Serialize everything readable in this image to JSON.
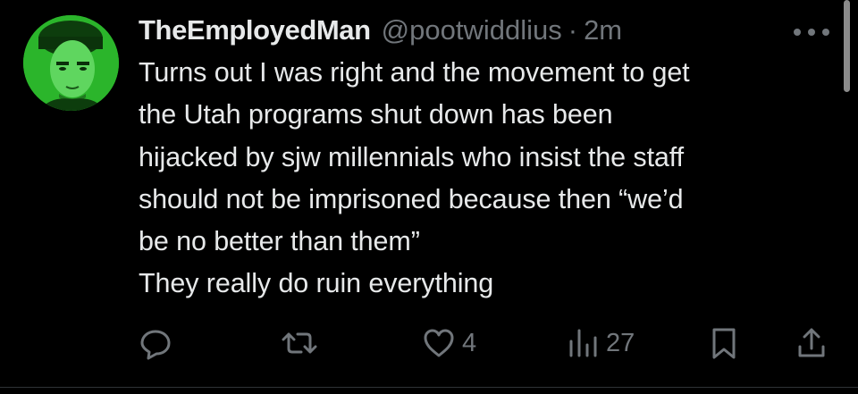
{
  "tweet": {
    "display_name": "TheEmployedMan",
    "handle": "@pootwiddlius",
    "separator": "·",
    "time": "2m",
    "text_lines": [
      "Turns out I was right and the movement to get",
      "the Utah programs shut down has been",
      "hijacked by sjw millennials who insist the staff",
      "should not be imprisoned because then “we’d",
      "be no better than them”",
      "They really do ruin everything"
    ]
  },
  "actions": {
    "likes": "4",
    "views": "27"
  },
  "icons": {
    "more": "more-horizontal-icon",
    "reply": "reply-icon",
    "retweet": "retweet-icon",
    "like": "heart-icon",
    "views": "views-chart-icon",
    "bookmark": "bookmark-icon",
    "share": "share-icon"
  },
  "colors": {
    "background": "#000000",
    "text_primary": "#e7e9ea",
    "text_secondary": "#71767b",
    "avatar_tint": "#1fa31f"
  }
}
